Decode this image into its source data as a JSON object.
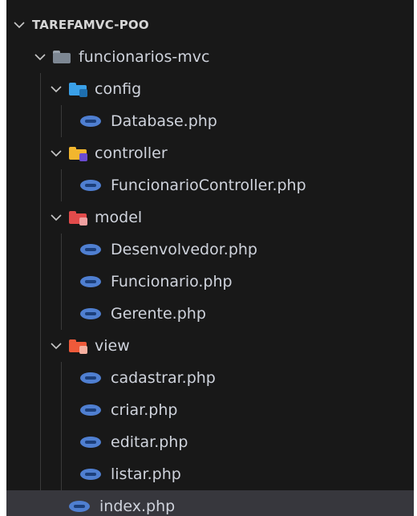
{
  "explorer": {
    "root": {
      "label": "TAREFAMVC-POO",
      "expanded": true
    },
    "project": {
      "label": "funcionarios-mvc",
      "expanded": true
    },
    "folders": [
      {
        "label": "config",
        "icon": "config-folder-icon",
        "color": "#3aa0e8",
        "badge": "#2a83c9",
        "files": [
          "Database.php"
        ]
      },
      {
        "label": "controller",
        "icon": "controller-folder-icon",
        "color": "#f2b62e",
        "badge": "#6a4bd1",
        "files": [
          "FuncionarioController.php"
        ]
      },
      {
        "label": "model",
        "icon": "model-folder-icon",
        "color": "#e24b4b",
        "badge": "#b02a2a",
        "files": [
          "Desenvolvedor.php",
          "Funcionario.php",
          "Gerente.php"
        ]
      },
      {
        "label": "view",
        "icon": "view-folder-icon",
        "color": "#ef5a3a",
        "badge": "#c93a23",
        "files": [
          "cadastrar.php",
          "criar.php",
          "editar.php",
          "listar.php"
        ]
      }
    ],
    "root_file": {
      "label": "index.php",
      "selected": true
    },
    "colors": {
      "background": "#181818",
      "selected": "#37373d",
      "text": "#cfd3dc",
      "php_icon": "#4f7fd1"
    }
  }
}
